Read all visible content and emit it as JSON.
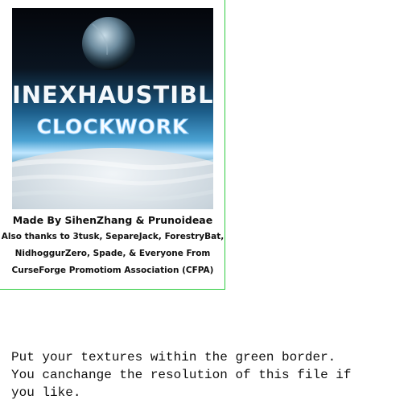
{
  "artwork": {
    "title_line1": "INEXHAUSTIBLE",
    "title_line2": "CLOCKWORK",
    "colors": {
      "space": "#05070c",
      "sky": "#5aa8d4",
      "glow": "#bfe6ff",
      "cloud": "#e8eef2"
    }
  },
  "credits": {
    "made_by": "Made By SihenZhang & Prunoideae",
    "thanks_lines": [
      "Also thanks to 3tusk, SepareJack, ForestryBat,",
      "NidhoggurZero, Spade, & Everyone From",
      "CurseForge Promotiom Association (CFPA)"
    ]
  },
  "instructions": {
    "lines": [
      "Put your textures within the green border.",
      "You canchange the resolution of this file if",
      "you like."
    ]
  },
  "colors": {
    "border": "#2ecc40"
  }
}
